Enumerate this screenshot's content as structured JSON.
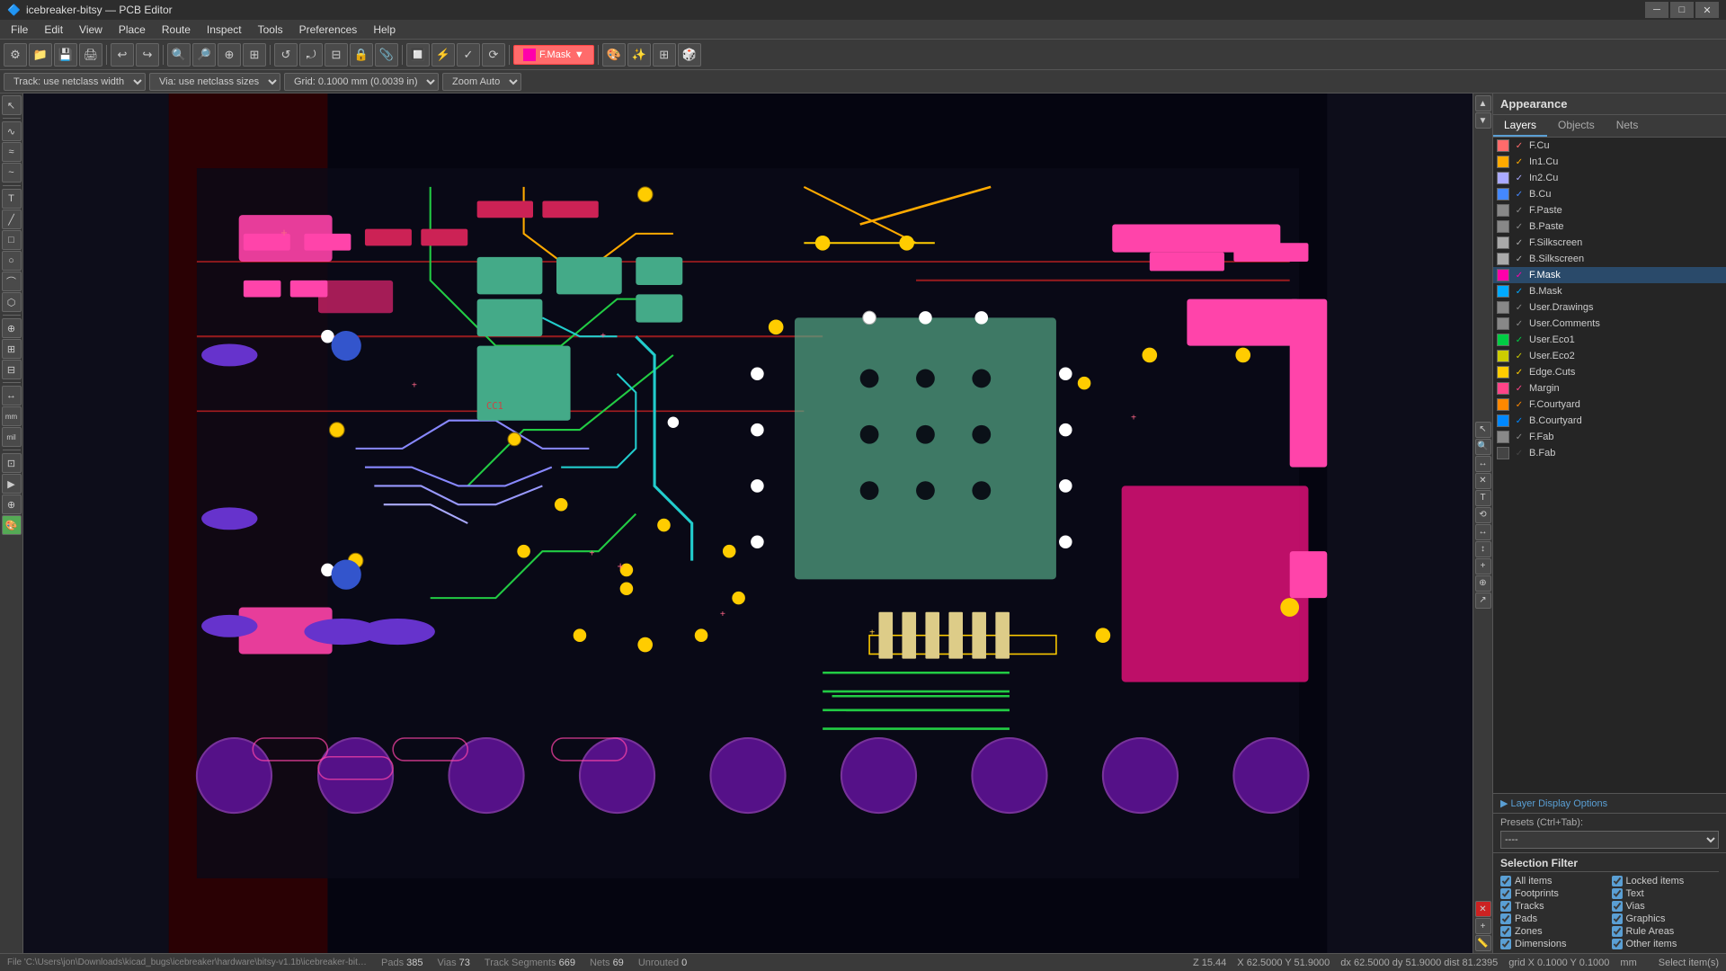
{
  "titlebar": {
    "title": "icebreaker-bitsy — PCB Editor",
    "icon": "🔷",
    "controls": [
      "─",
      "□",
      "✕"
    ]
  },
  "menubar": {
    "items": [
      "File",
      "Edit",
      "View",
      "Place",
      "Route",
      "Inspect",
      "Tools",
      "Preferences",
      "Help"
    ]
  },
  "toolbar": {
    "buttons": [
      "⚙",
      "📂",
      "💾",
      "🖨",
      "✂",
      "↩",
      "↪",
      "🔍-",
      "🔍",
      "🔍+",
      "🔍fit",
      "⊕",
      "↺",
      "⤾",
      "⊞",
      "⊠",
      "🔒",
      "📎",
      "🔲",
      "✂",
      "🎨",
      "🎯",
      "⚡",
      "⚡2"
    ],
    "layer_select": "F.Mask",
    "theme_btn": "🎨",
    "highlight_btn": "✨",
    "pad_btn": "⊞"
  },
  "toolbar2": {
    "track_select": "Track: use netclass width",
    "via_select": "Via: use netclass sizes",
    "grid_select": "Grid: 0.1000 mm (0.0039 in)",
    "zoom_select": "Zoom Auto"
  },
  "left_toolbar": {
    "buttons": [
      "↖",
      "⊕",
      "✎",
      "⊡",
      "T",
      "∿",
      "⊞",
      "⊟",
      "✦",
      "⊕+",
      "∿2",
      "⊕±",
      "⊡2",
      "R",
      "⚡",
      "📐",
      "⊕3",
      "mm",
      "mil",
      "🔧",
      "⊕4",
      "▶"
    ]
  },
  "right_toolbar": {
    "buttons": [
      "▲",
      "▼",
      "🔍+",
      "🔍-",
      "◉",
      "✕",
      "T",
      "⟲",
      "↔",
      "↕",
      "+",
      "⊕",
      "↗"
    ]
  },
  "appearance": {
    "title": "Appearance",
    "tabs": [
      "Layers",
      "Objects",
      "Nets"
    ],
    "active_tab": "Layers",
    "layers": [
      {
        "name": "F.Cu",
        "color": "#ff6b6b",
        "visible": true,
        "selected": false
      },
      {
        "name": "In1.Cu",
        "color": "#ffaa00",
        "visible": true,
        "selected": false
      },
      {
        "name": "In2.Cu",
        "color": "#aaaaff",
        "visible": true,
        "selected": false
      },
      {
        "name": "B.Cu",
        "color": "#4488ff",
        "visible": true,
        "selected": false
      },
      {
        "name": "F.Paste",
        "color": "#888888",
        "visible": true,
        "selected": false
      },
      {
        "name": "B.Paste",
        "color": "#888888",
        "visible": true,
        "selected": false
      },
      {
        "name": "F.Silkscreen",
        "color": "#aaaaaa",
        "visible": true,
        "selected": false
      },
      {
        "name": "B.Silkscreen",
        "color": "#aaaaaa",
        "visible": true,
        "selected": false
      },
      {
        "name": "F.Mask",
        "color": "#ff00aa",
        "visible": true,
        "selected": true
      },
      {
        "name": "B.Mask",
        "color": "#00aaff",
        "visible": true,
        "selected": false
      },
      {
        "name": "User.Drawings",
        "color": "#888888",
        "visible": true,
        "selected": false
      },
      {
        "name": "User.Comments",
        "color": "#888888",
        "visible": true,
        "selected": false
      },
      {
        "name": "User.Eco1",
        "color": "#00cc44",
        "visible": true,
        "selected": false
      },
      {
        "name": "User.Eco2",
        "color": "#cccc00",
        "visible": true,
        "selected": false
      },
      {
        "name": "Edge.Cuts",
        "color": "#ffcc00",
        "visible": true,
        "selected": false
      },
      {
        "name": "Margin",
        "color": "#ff4488",
        "visible": true,
        "selected": false
      },
      {
        "name": "F.Courtyard",
        "color": "#ff8800",
        "visible": true,
        "selected": false
      },
      {
        "name": "B.Courtyard",
        "color": "#0088ff",
        "visible": true,
        "selected": false
      },
      {
        "name": "F.Fab",
        "color": "#888888",
        "visible": true,
        "selected": false
      },
      {
        "name": "B.Fab",
        "color": "#444444",
        "visible": true,
        "selected": false
      }
    ],
    "layer_display_options": "▶ Layer Display Options",
    "presets_label": "Presets (Ctrl+Tab):",
    "presets_value": "----"
  },
  "selection_filter": {
    "title": "Selection Filter",
    "items_left": [
      {
        "label": "All items",
        "checked": true
      },
      {
        "label": "Footprints",
        "checked": true
      },
      {
        "label": "Tracks",
        "checked": true
      },
      {
        "label": "Pads",
        "checked": true
      },
      {
        "label": "Zones",
        "checked": true
      },
      {
        "label": "Dimensions",
        "checked": true
      }
    ],
    "items_right": [
      {
        "label": "Locked items",
        "checked": true
      },
      {
        "label": "Text",
        "checked": true
      },
      {
        "label": "Vias",
        "checked": true
      },
      {
        "label": "Graphics",
        "checked": true
      },
      {
        "label": "Rule Areas",
        "checked": true
      },
      {
        "label": "Other items",
        "checked": true
      }
    ]
  },
  "statusbar": {
    "pads_label": "Pads",
    "pads_value": "385",
    "vias_label": "Vias",
    "vias_value": "73",
    "track_label": "Track Segments",
    "track_value": "669",
    "nets_label": "Nets",
    "nets_value": "69",
    "unrouted_label": "Unrouted",
    "unrouted_value": "0",
    "file_path": "File 'C:\\Users\\jon\\Downloads\\kicad_bugs\\icebreaker\\hardware\\bitsy-v1.1b\\icebreaker-bitsy.kicad_pcb' saved.",
    "z_label": "Z",
    "z_value": "15.44",
    "x_label": "X",
    "x_value": "62.5000",
    "y_label": "Y",
    "y_value": "51.9000",
    "dx_label": "dx",
    "dx_value": "62.5000",
    "dy_label": "dy",
    "dy_value": "51.9000",
    "dist_label": "dist",
    "dist_value": "81.2395",
    "grid_label": "grid",
    "grid_x": "0.1000",
    "grid_y": "0.1000",
    "unit": "mm",
    "mode": "Select item(s)"
  }
}
